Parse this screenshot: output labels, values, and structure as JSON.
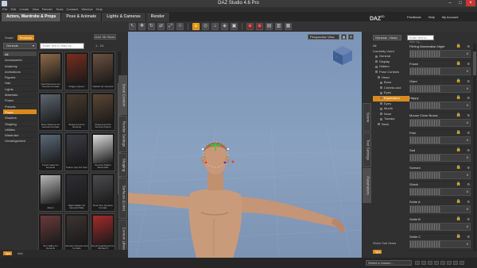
{
  "window": {
    "title": "DAZ Studio 4.6 Pro",
    "min": "–",
    "max": "□",
    "close": "×"
  },
  "menubar": [
    "File",
    "Edit",
    "Create",
    "View",
    "Render",
    "Tools",
    "Connect",
    "Window",
    "Help"
  ],
  "room_tabs": [
    {
      "label": "Actors, Wardrobe & Props",
      "active": true
    },
    {
      "label": "Pose & Animate",
      "active": false
    },
    {
      "label": "Lights & Cameras",
      "active": false
    },
    {
      "label": "Render",
      "active": false
    }
  ],
  "brand": {
    "logo": "DAZ",
    "logo_sup": "3D"
  },
  "top_links": [
    "Feedback",
    "Help",
    "My Account"
  ],
  "left_panel": {
    "tabs": [
      "Smart",
      "Products"
    ],
    "active_tab": "Products",
    "daz_button": "DAZ 3D Store",
    "category_dropdown": "Genesis",
    "filter_placeholder": "Enter text to filter by...",
    "pager": "1 - 24",
    "categories": [
      "All",
      "Accessories",
      "Anatomy",
      "Animations",
      "Figures",
      "Hair",
      "Lights",
      "Materials",
      "Poses",
      "Presets",
      "Props",
      "Shaders",
      "Shaping",
      "Utilities",
      "Wardrobe",
      "Uncategorized"
    ],
    "selected_category": "Props",
    "thumbnails": [
      {
        "caption": "Vasil Monstone for Genesis Female",
        "color": "#8c6a48"
      },
      {
        "caption": "Dragon Queen",
        "color": "#7a2e1e"
      },
      {
        "caption": "Defiant for Genesis",
        "color": "#6d5140"
      },
      {
        "caption": "Brise Waitress for Genesis Female",
        "color": "#5c6670"
      },
      {
        "caption": "Shaped and for Genesis",
        "color": "#4a3c2c"
      },
      {
        "caption": "Shaped and for Genesis Figure",
        "color": "#5e4634"
      },
      {
        "caption": "Fresh Gears for Genesis",
        "color": "#5a6a7a"
      },
      {
        "caption": "Future Cop For Gen",
        "color": "#3c3c46"
      },
      {
        "caption": "Genesis Starter Essentials",
        "color": "#dcdcdc"
      },
      {
        "caption": "Aliens",
        "color": "#b8b8b8"
      },
      {
        "caption": "Night Stalker for Genesis Male",
        "color": "#2e2e34"
      },
      {
        "caption": "Rock Fire Genesis Female",
        "color": "#4c4a4e"
      },
      {
        "caption": "Sun Valley for Genesis",
        "color": "#6a3a3a"
      },
      {
        "caption": "Reverie Genesis 2nd Female",
        "color": "#3c3432"
      },
      {
        "caption": "Royal Guardsman for Michael 5",
        "color": "#a42a2a"
      }
    ],
    "side_tabs": [
      "Smart Content",
      "Render Settings",
      "Shaping",
      "Surfaces (Color)",
      "Content Library"
    ],
    "active_side_tab": "Smart Content",
    "bottom_tips": "Tips",
    "bottom_info": "Info"
  },
  "viewport": {
    "view_dropdown": "Perspective View",
    "buttons": [
      "▦",
      "⚙"
    ]
  },
  "right_panel": {
    "side_tabs": [
      "Scene",
      "Tool Settings",
      "Parameters"
    ],
    "active_side_tab": "Parameters",
    "node_dropdown": "Genesis : Head",
    "filter_placeholder": "Enter text to filter by...",
    "tree": [
      {
        "label": "All",
        "indent": 0,
        "sel": false,
        "box": false
      },
      {
        "label": "Currently Used",
        "indent": 0,
        "sel": false,
        "box": false
      },
      {
        "label": "General",
        "indent": 1,
        "sel": false,
        "box": true
      },
      {
        "label": "Display",
        "indent": 1,
        "sel": false,
        "box": true
      },
      {
        "label": "Hidden",
        "indent": 1,
        "sel": false,
        "box": true
      },
      {
        "label": "Pose Controls",
        "indent": 1,
        "sel": false,
        "box": true
      },
      {
        "label": "Head",
        "indent": 2,
        "sel": false,
        "box": true
      },
      {
        "label": "Brow",
        "indent": 3,
        "sel": false,
        "box": true
      },
      {
        "label": "Cheeks and",
        "indent": 3,
        "sel": false,
        "box": true
      },
      {
        "label": "Eyes",
        "indent": 3,
        "sel": false,
        "box": true
      },
      {
        "label": "Expression",
        "indent": 3,
        "sel": true,
        "box": true
      },
      {
        "label": "Eyes",
        "indent": 3,
        "sel": false,
        "box": true
      },
      {
        "label": "Mouth",
        "indent": 3,
        "sel": false,
        "box": true
      },
      {
        "label": "Nose",
        "indent": 3,
        "sel": false,
        "box": true
      },
      {
        "label": "Tweaks",
        "indent": 3,
        "sel": false,
        "box": true
      },
      {
        "label": "Neck",
        "indent": 2,
        "sel": false,
        "box": true
      }
    ],
    "sliders": [
      {
        "name": "Flirting Mammalian Night",
        "value": "0",
        "fill": 0
      },
      {
        "name": "Frown",
        "value": "0",
        "fill": 0
      },
      {
        "name": "Glare",
        "value": "0",
        "fill": 0
      },
      {
        "name": "Happy",
        "value": "0",
        "fill": 0
      },
      {
        "name": "Mouse Close Brows",
        "value": "0",
        "fill": 0
      },
      {
        "name": "Pain",
        "value": "0",
        "fill": 0
      },
      {
        "name": "Sad",
        "value": "0",
        "fill": 0
      },
      {
        "name": "Scream",
        "value": "0",
        "fill": 0
      },
      {
        "name": "Shock",
        "value": "0",
        "fill": 0
      },
      {
        "name": "Smile A",
        "value": "0",
        "fill": 0
      },
      {
        "name": "Smile B",
        "value": "0",
        "fill": 0
      },
      {
        "name": "Smile C",
        "value": "0",
        "fill": 0
      }
    ],
    "show_sub_items": "Show Sub Items",
    "bottom_tips": "Tips"
  },
  "statusbar": {
    "lesson": "Select a Lesson..."
  }
}
